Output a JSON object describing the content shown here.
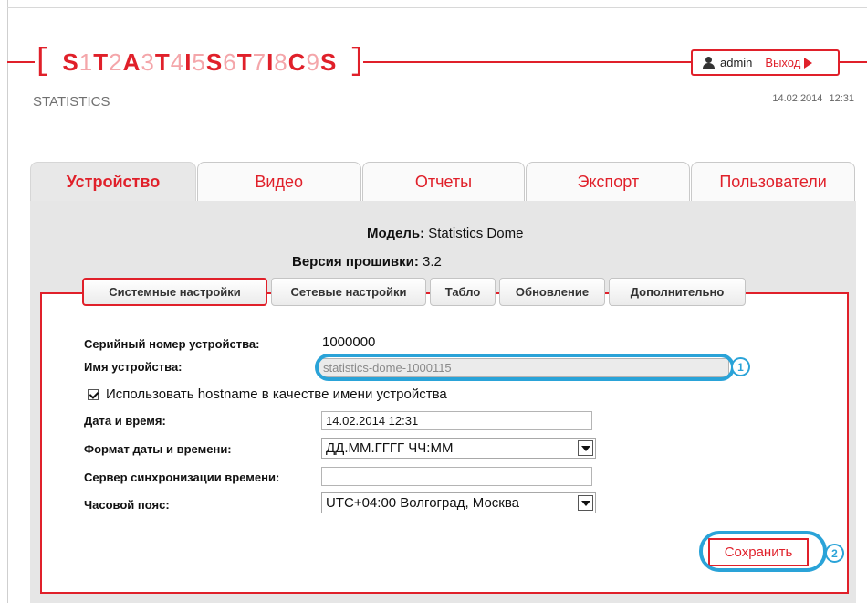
{
  "header": {
    "logo_text": "S1T2A3T4I5S6T7I8C9S",
    "subtitle": "STATISTICS",
    "user": "admin",
    "logout_label": "Выход",
    "datetime": "14.02.2014 12:31"
  },
  "main_tabs": [
    {
      "label": "Устройство"
    },
    {
      "label": "Видео"
    },
    {
      "label": "Отчеты"
    },
    {
      "label": "Экспорт"
    },
    {
      "label": "Пользователи"
    }
  ],
  "device_info": {
    "model_label": "Модель:",
    "model_value": "Statistics Dome",
    "firmware_label": "Версия прошивки:",
    "firmware_value": "3.2"
  },
  "sub_tabs": [
    {
      "label": "Системные настройки"
    },
    {
      "label": "Сетевые настройки"
    },
    {
      "label": "Табло"
    },
    {
      "label": "Обновление"
    },
    {
      "label": "Дополнительно"
    }
  ],
  "form": {
    "serial_label": "Серийный номер устройства:",
    "serial_value": "1000000",
    "name_label": "Имя устройства:",
    "name_value": "statistics-dome-1000115",
    "hostname_checkbox_label": "Использовать hostname в качестве имени устройства",
    "hostname_checked": true,
    "datetime_label": "Дата и время:",
    "datetime_value": "14.02.2014 12:31",
    "format_label": "Формат даты и времени:",
    "format_value": "ДД.ММ.ГГГГ ЧЧ:ММ",
    "ntp_label": "Сервер синхронизации времени:",
    "ntp_value": "",
    "timezone_label": "Часовой пояс:",
    "timezone_value": "UTC+04:00 Волгоград, Москва",
    "save_label": "Сохранить"
  },
  "callouts": [
    "1",
    "2"
  ],
  "colors": {
    "accent": "#e0202a",
    "callout": "#2aa3d8",
    "panel": "#e6e6e6"
  }
}
